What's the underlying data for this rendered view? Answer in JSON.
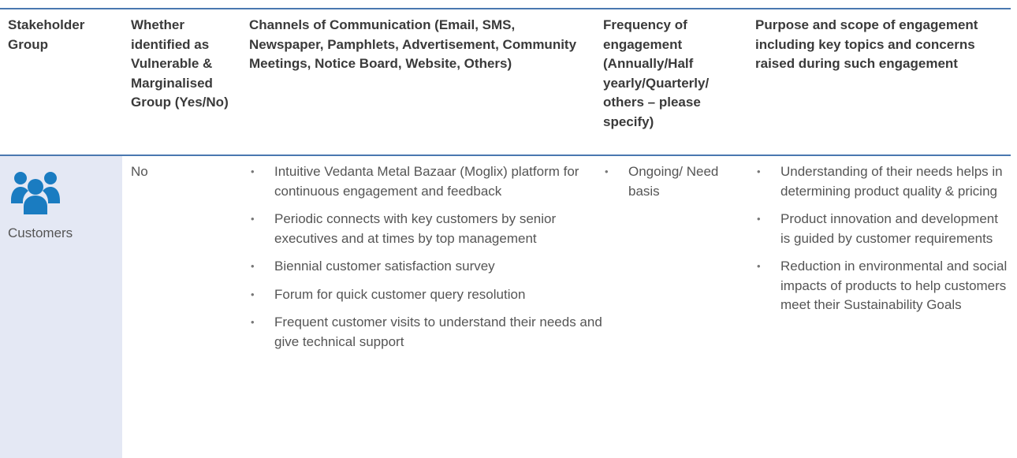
{
  "colors": {
    "rule": "#4a78b0",
    "icon": "#1a7cc1",
    "group_bg": "#e4e8f4"
  },
  "headers": {
    "stakeholder_group": "Stakeholder Group",
    "vulnerable": "Whether identified as Vulnerable & Marginalised Group (Yes/No)",
    "channels": "Channels of Communication (Email, SMS, Newspaper, Pamphlets, Advertisement, Community Meetings, Notice Board, Website, Others)",
    "frequency": "Frequency of engagement (Annually/Half yearly/Quarterly/ others – please specify)",
    "purpose": "Purpose and scope of engagement including key topics and concerns raised during such engagement"
  },
  "rows": [
    {
      "icon": "people-group-icon",
      "group": "Customers",
      "vulnerable": "No",
      "channels": [
        "Intuitive Vedanta Metal Bazaar (Moglix) platform for continuous engagement and feedback",
        "Periodic connects with key customers by senior executives and at times by top management",
        "Biennial customer satisfaction survey",
        "Forum for quick customer query resolution",
        "Frequent customer visits to understand their needs and give technical support"
      ],
      "frequency": [
        "Ongoing/ Need basis"
      ],
      "purpose": [
        "Understanding of their needs helps in determining product quality & pricing",
        "Product innovation and development is guided by customer requirements",
        "Reduction in environmental and social impacts of products to help customers meet their Sustainability Goals"
      ]
    }
  ]
}
